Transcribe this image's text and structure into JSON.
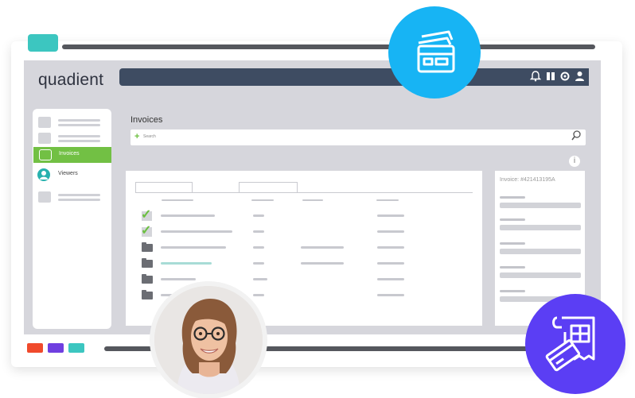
{
  "brand": {
    "logo_text": "quadient"
  },
  "colors": {
    "accent_green": "#72c044",
    "topbar": "#3e4c62",
    "circle_blue": "#17b4f4",
    "circle_purple": "#5b3ef4",
    "teal": "#3cc6c0"
  },
  "topbar": {
    "icons": [
      "bell-icon",
      "columns-icon",
      "gear-icon",
      "user-icon"
    ]
  },
  "sidebar": {
    "items": [
      {
        "label": "Invoices",
        "active": true
      },
      {
        "label": "Viewers",
        "active": false
      }
    ]
  },
  "main": {
    "title": "Invoices",
    "search_placeholder": "Search"
  },
  "detail": {
    "title": "Invoice: #421413195A"
  },
  "badges": {
    "left_chip_colors": [
      "#f04a2c",
      "#6f3fe0",
      "#3cc6c0"
    ]
  }
}
